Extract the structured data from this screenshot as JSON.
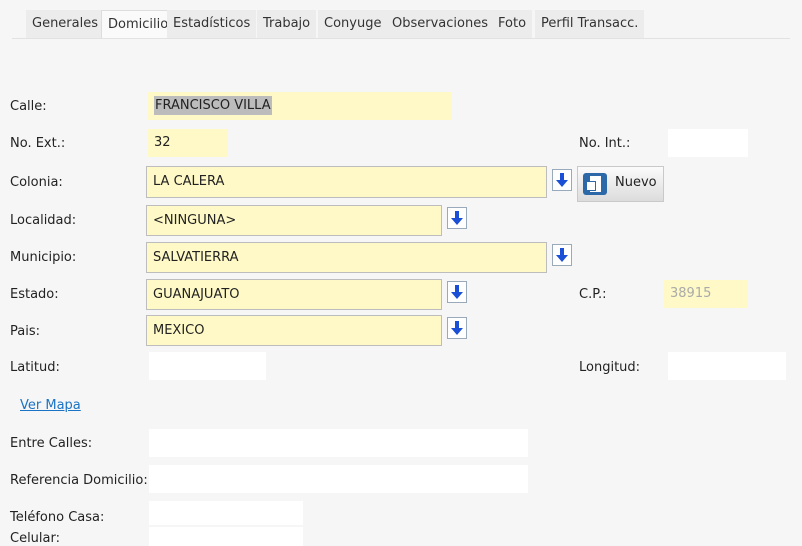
{
  "tabs": [
    "Generales",
    "Domicilio",
    "Estadísticos",
    "Trabajo",
    "Conyuge",
    "Observaciones",
    "Foto",
    "Perfil Transacc."
  ],
  "labels": {
    "calle": "Calle:",
    "no_ext": "No. Ext.:",
    "no_int": "No. Int.:",
    "colonia": "Colonia:",
    "localidad": "Localidad:",
    "municipio": "Municipio:",
    "estado": "Estado:",
    "cp": "C.P.:",
    "pais": "Pais:",
    "latitud": "Latitud:",
    "longitud": "Longitud:",
    "entre_calles": "Entre Calles:",
    "referencia": "Referencia Domicilio:",
    "telefono": "Teléfono Casa:",
    "celular": "Celular:"
  },
  "values": {
    "calle": "FRANCISCO VILLA",
    "no_ext": "32",
    "no_int": "",
    "colonia": "LA CALERA",
    "localidad": "<NINGUNA>",
    "municipio": "SALVATIERRA",
    "estado": "GUANAJUATO",
    "cp": "38915",
    "pais": "MEXICO",
    "latitud": "",
    "longitud": "",
    "entre_calles": "",
    "referencia": "",
    "telefono": "",
    "celular": ""
  },
  "buttons": {
    "nuevo": "Nuevo"
  },
  "links": {
    "ver_mapa": "Ver Mapa"
  },
  "colors": {
    "field_yellow": "#fef9c6",
    "link": "#1a73c4",
    "arrow": "#1a4fd6"
  }
}
